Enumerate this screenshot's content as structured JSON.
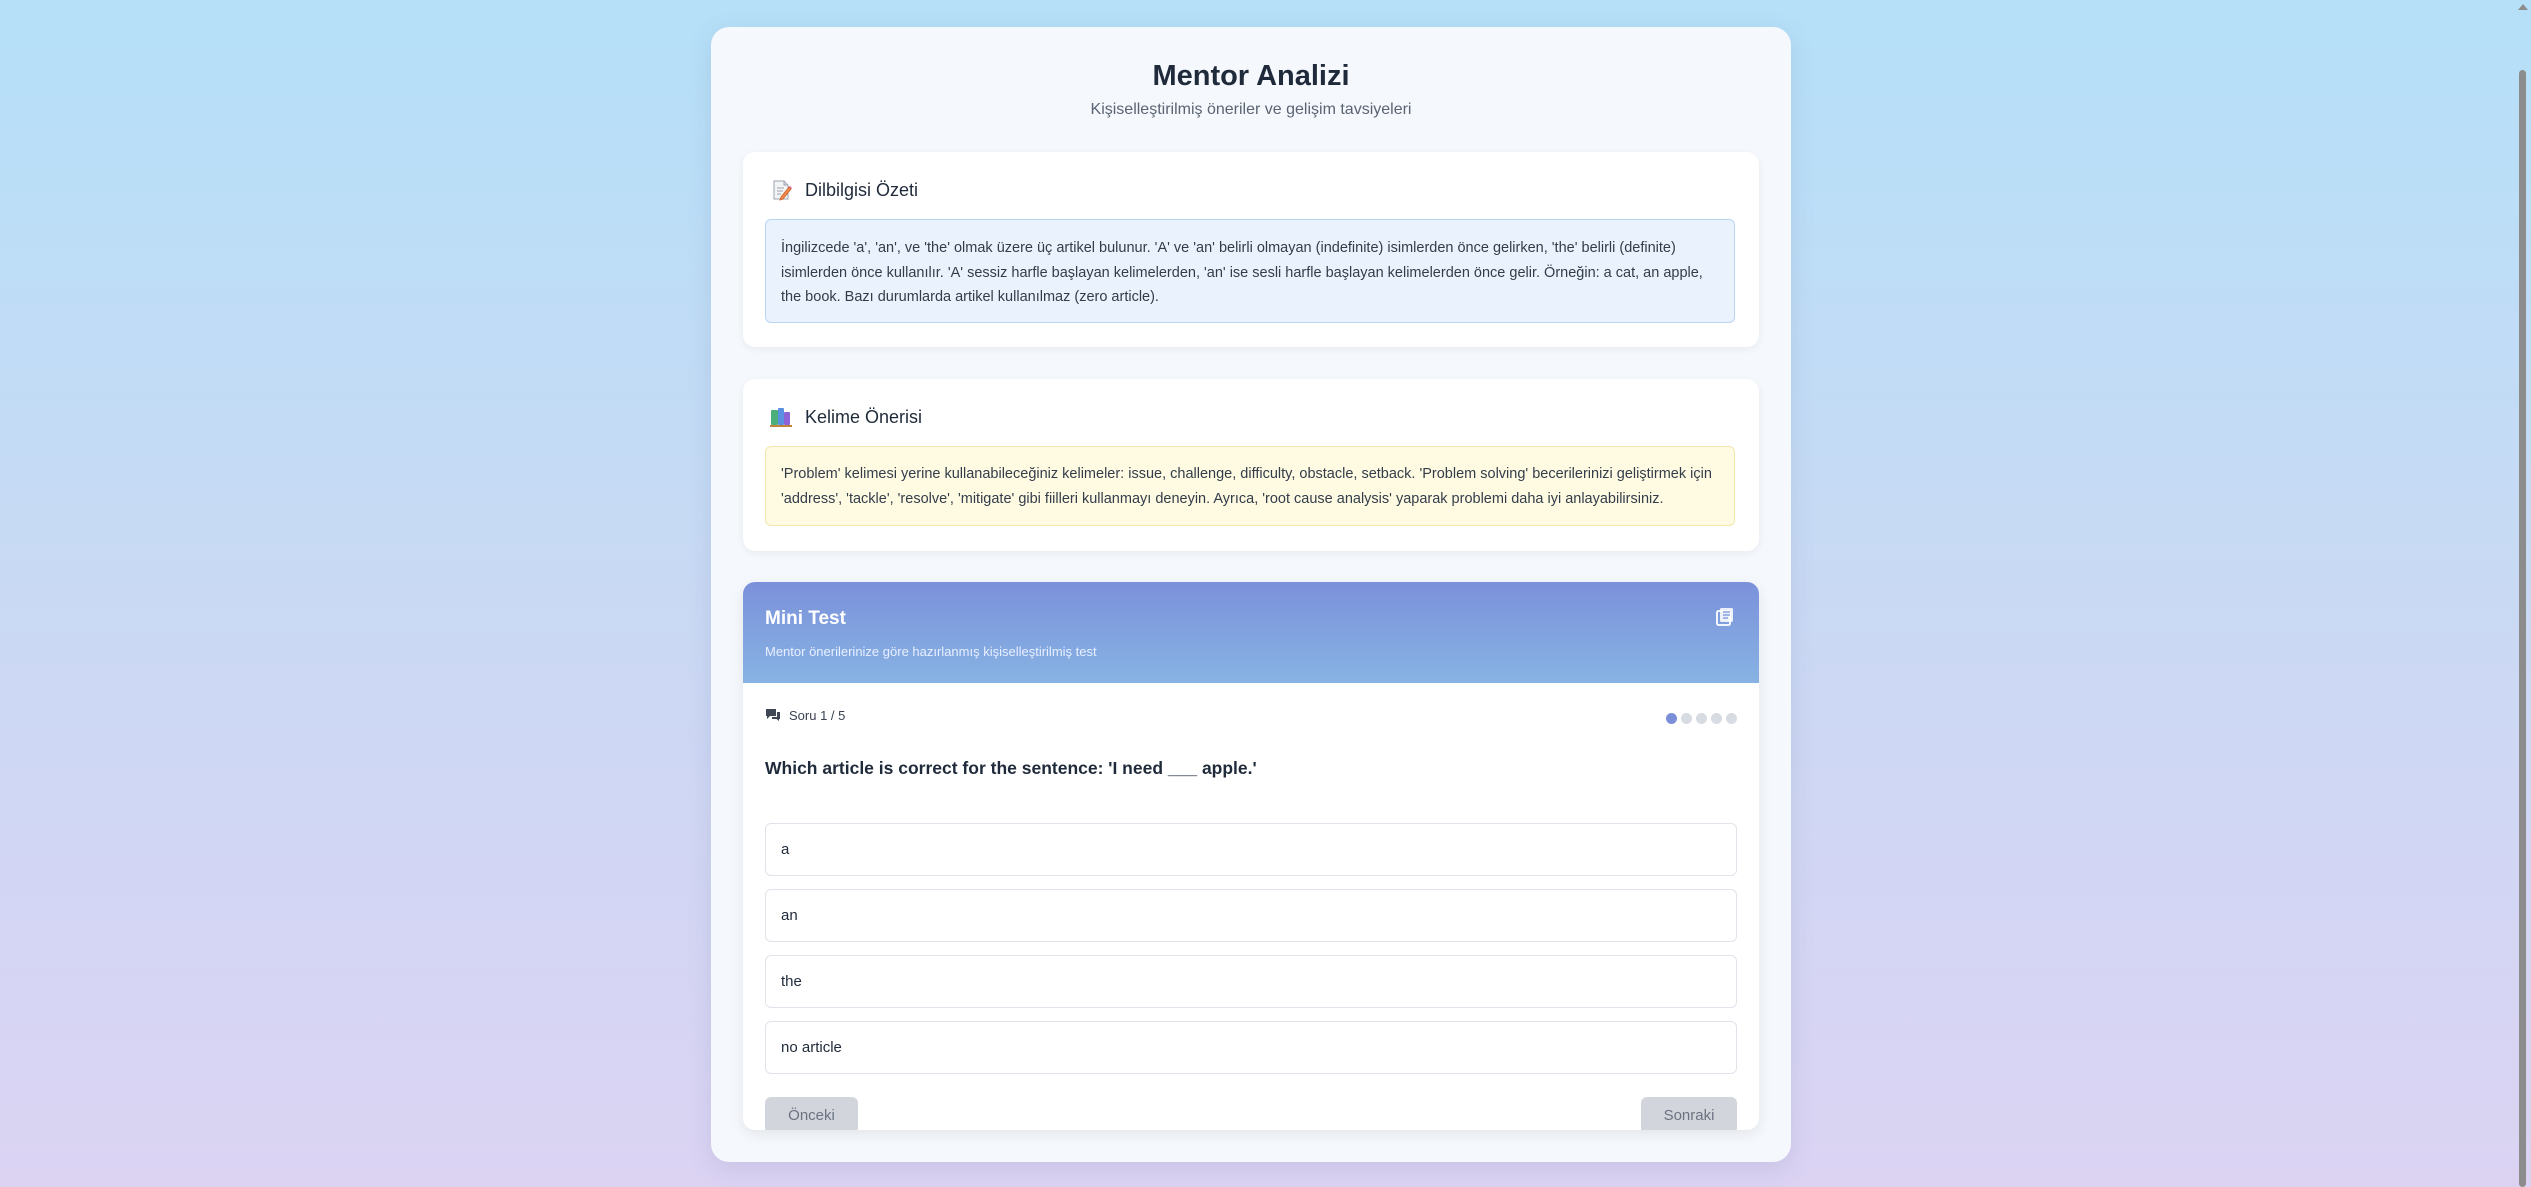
{
  "page": {
    "title": "Mentor Analizi",
    "subtitle": "Kişiselleştirilmiş öneriler ve gelişim tavsiyeleri"
  },
  "grammar_card": {
    "title": "Dilbilgisi Özeti",
    "icon": "memo-icon",
    "text": "İngilizcede 'a', 'an', ve 'the' olmak üzere üç artikel bulunur. 'A' ve 'an' belirli olmayan (indefinite) isimlerden önce gelirken, 'the' belirli (definite) isimlerden önce kullanılır. 'A' sessiz harfle başlayan kelimelerden, 'an' ise sesli harfle başlayan kelimelerden önce gelir. Örneğin: a cat, an apple, the book. Bazı durumlarda artikel kullanılmaz (zero article)."
  },
  "vocab_card": {
    "title": "Kelime Önerisi",
    "icon": "books-icon",
    "text": "'Problem' kelimesi yerine kullanabileceğiniz kelimeler: issue, challenge, difficulty, obstacle, setback. 'Problem solving' becerilerinizi geliştirmek için 'address', 'tackle', 'resolve', 'mitigate' gibi fiilleri kullanmayı deneyin. Ayrıca, 'root cause analysis' yaparak problemi daha iyi anlayabilirsiniz."
  },
  "mini_test": {
    "title": "Mini Test",
    "subtitle": "Mentor önerilerinize göre hazırlanmış kişiselleştirilmiş test",
    "header_icon": "quiz-book-icon",
    "progress_label": "Soru 1 / 5",
    "progress_icon": "chat-bubble-icon",
    "current_question": 1,
    "total_questions": 5,
    "question": "Which article is correct for the sentence: 'I need ___ apple.'",
    "options": [
      "a",
      "an",
      "the",
      "no article"
    ],
    "prev_label": "Önceki",
    "next_label": "Sonraki"
  },
  "colors": {
    "accent": "#7b8fd8",
    "grammar_box_bg": "#eaf3fd",
    "vocab_box_bg": "#fffbe3"
  }
}
